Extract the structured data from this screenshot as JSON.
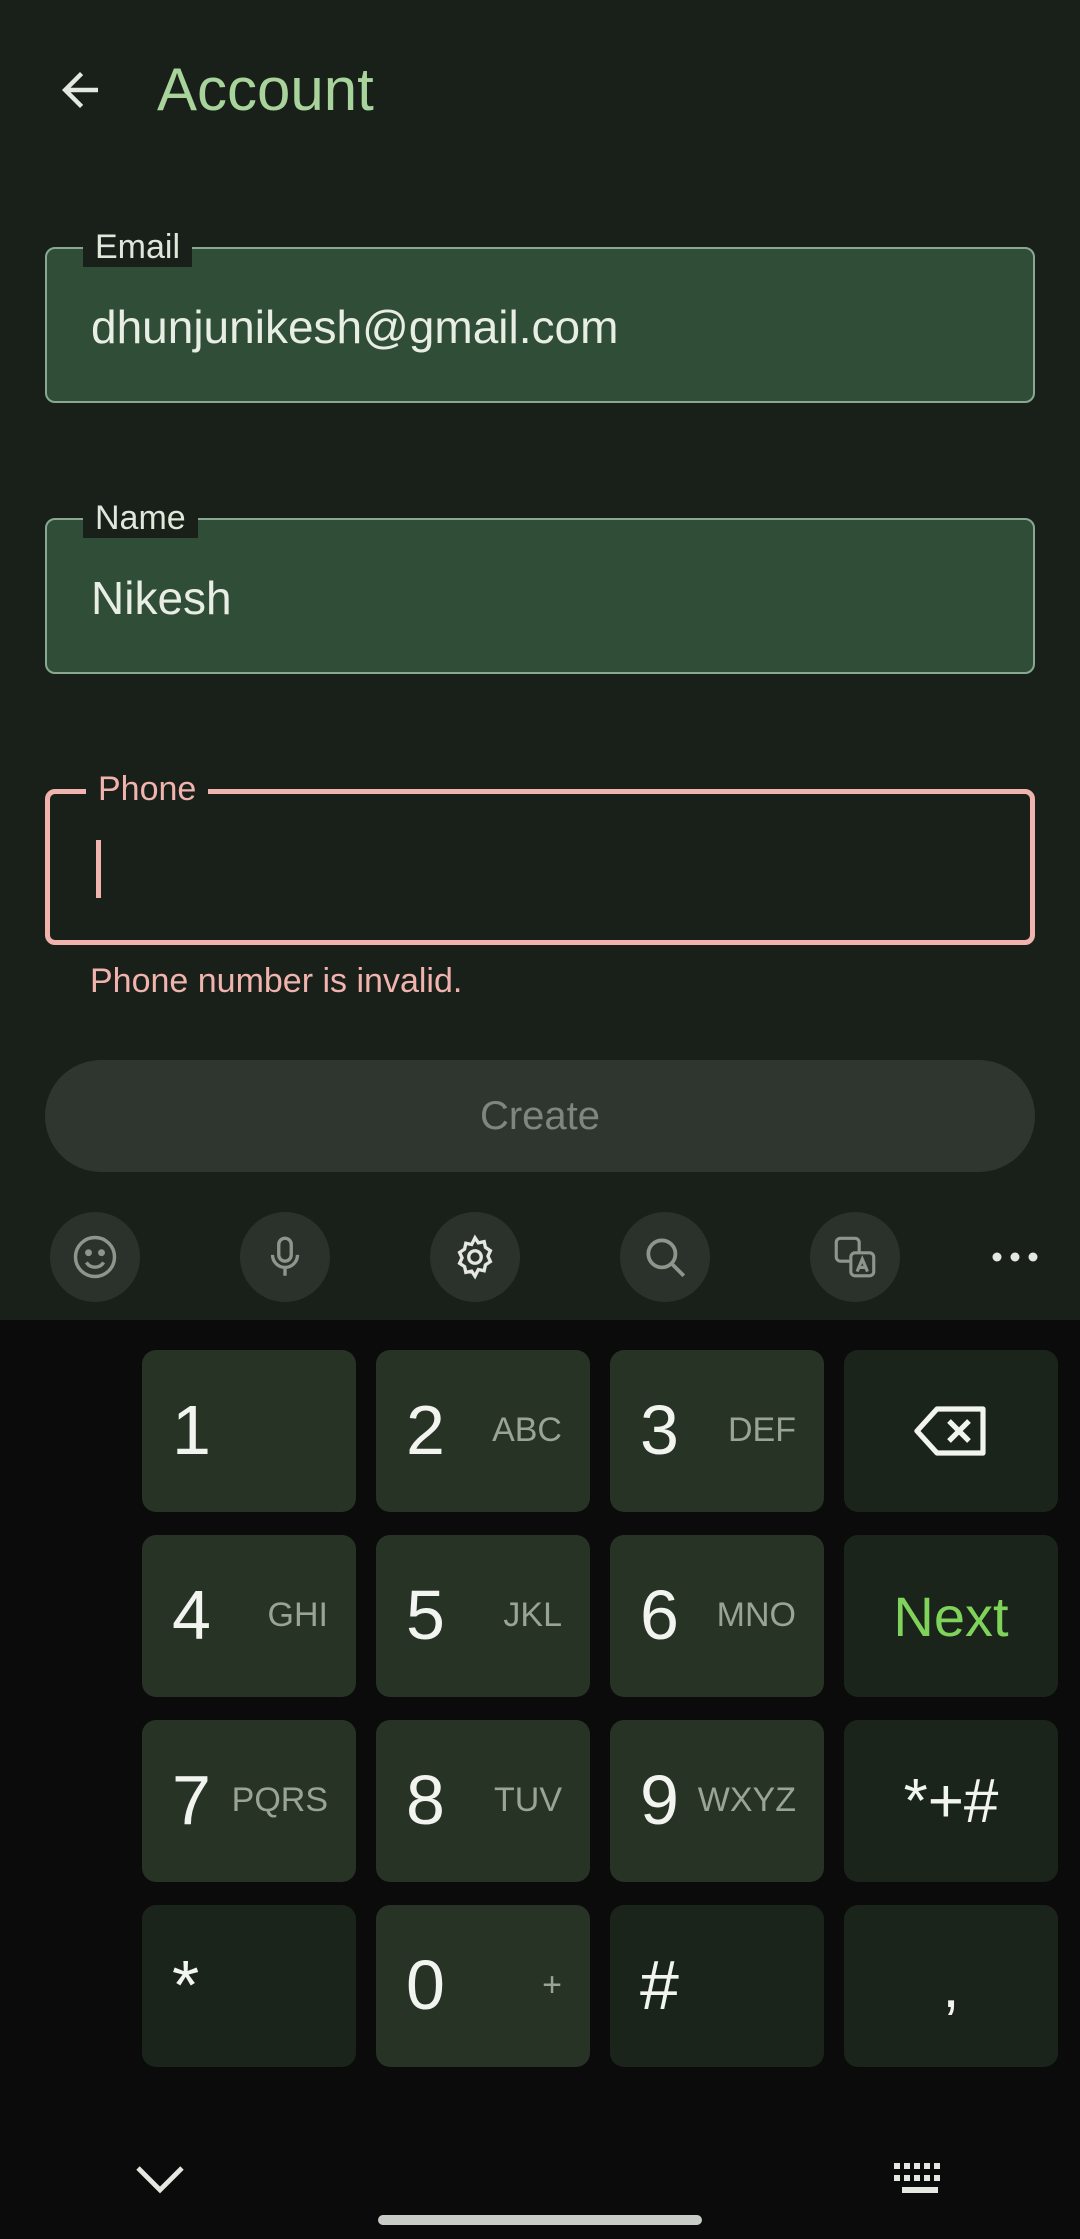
{
  "header": {
    "title": "Account"
  },
  "form": {
    "email": {
      "label": "Email",
      "value": "dhunjunikesh@gmail.com"
    },
    "name": {
      "label": "Name",
      "value": "Nikesh"
    },
    "phone": {
      "label": "Phone",
      "value": "",
      "error": "Phone number is invalid."
    },
    "create_label": "Create"
  },
  "keyboard_toolbar": [
    "emoji-icon",
    "microphone-icon",
    "gear-icon",
    "search-icon",
    "translate-icon",
    "more-icon"
  ],
  "keys": {
    "k1": {
      "num": "1",
      "letters": ""
    },
    "k2": {
      "num": "2",
      "letters": "ABC"
    },
    "k3": {
      "num": "3",
      "letters": "DEF"
    },
    "k4": {
      "num": "4",
      "letters": "GHI"
    },
    "k5": {
      "num": "5",
      "letters": "JKL"
    },
    "k6": {
      "num": "6",
      "letters": "MNO"
    },
    "k7": {
      "num": "7",
      "letters": "PQRS"
    },
    "k8": {
      "num": "8",
      "letters": "TUV"
    },
    "k9": {
      "num": "9",
      "letters": "WXYZ"
    },
    "k0": {
      "num": "0",
      "letters": "+"
    },
    "star": "*",
    "hash": "#",
    "symbols": "*+#",
    "comma": ",",
    "next": "Next"
  },
  "colors": {
    "accent": "#a8d39a",
    "error": "#f0b3ad",
    "next": "#7fd35a"
  }
}
